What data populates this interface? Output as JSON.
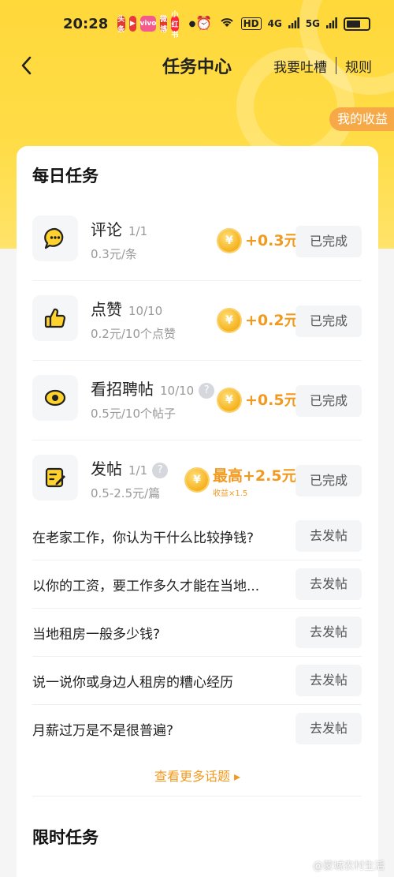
{
  "status_bar": {
    "time": "20:28",
    "apps": [
      "头条",
      "▶",
      "vivo",
      "微博",
      "小红书"
    ],
    "network": "HD",
    "signal_1": "4G",
    "signal_2": "5G"
  },
  "nav": {
    "title": "任务中心",
    "feedback": "我要吐槽",
    "rules": "规则"
  },
  "earnings_tag": "我的收益",
  "daily": {
    "title": "每日任务",
    "tasks": [
      {
        "name": "评论",
        "count": "1/1",
        "desc": "0.3元/条",
        "reward": "+0.3元",
        "status": "已完成",
        "icon": "comment-icon"
      },
      {
        "name": "点赞",
        "count": "10/10",
        "desc": "0.2元/10个点赞",
        "reward": "+0.2元",
        "status": "已完成",
        "icon": "thumbs-up-icon"
      },
      {
        "name": "看招聘帖",
        "count": "10/10",
        "desc": "0.5元/10个帖子",
        "reward": "+0.5元",
        "status": "已完成",
        "icon": "eye-icon"
      },
      {
        "name": "发帖",
        "count": "1/1",
        "desc": "0.5-2.5元/篇",
        "reward": "最高+2.5元",
        "reward_sub": "收益×1.5",
        "status": "已完成",
        "icon": "edit-icon"
      }
    ],
    "coin_symbol": "¥",
    "help_symbol": "?"
  },
  "topics": {
    "items": [
      {
        "text": "在老家工作，你认为干什么比较挣钱?",
        "action": "去发帖"
      },
      {
        "text": "以你的工资，要工作多久才能在当地...",
        "action": "去发帖"
      },
      {
        "text": "当地租房一般多少钱?",
        "action": "去发帖"
      },
      {
        "text": "说一说你或身边人租房的糟心经历",
        "action": "去发帖"
      },
      {
        "text": "月薪过万是不是很普遍?",
        "action": "去发帖"
      }
    ],
    "more": "查看更多话题 ▸"
  },
  "limited": {
    "title": "限时任务"
  },
  "watermark": "@蒙城农村生活",
  "colors": {
    "hero_yellow": "#ffd83a",
    "reward_orange": "#f29a1f",
    "tag_orange": "#f7a948"
  }
}
